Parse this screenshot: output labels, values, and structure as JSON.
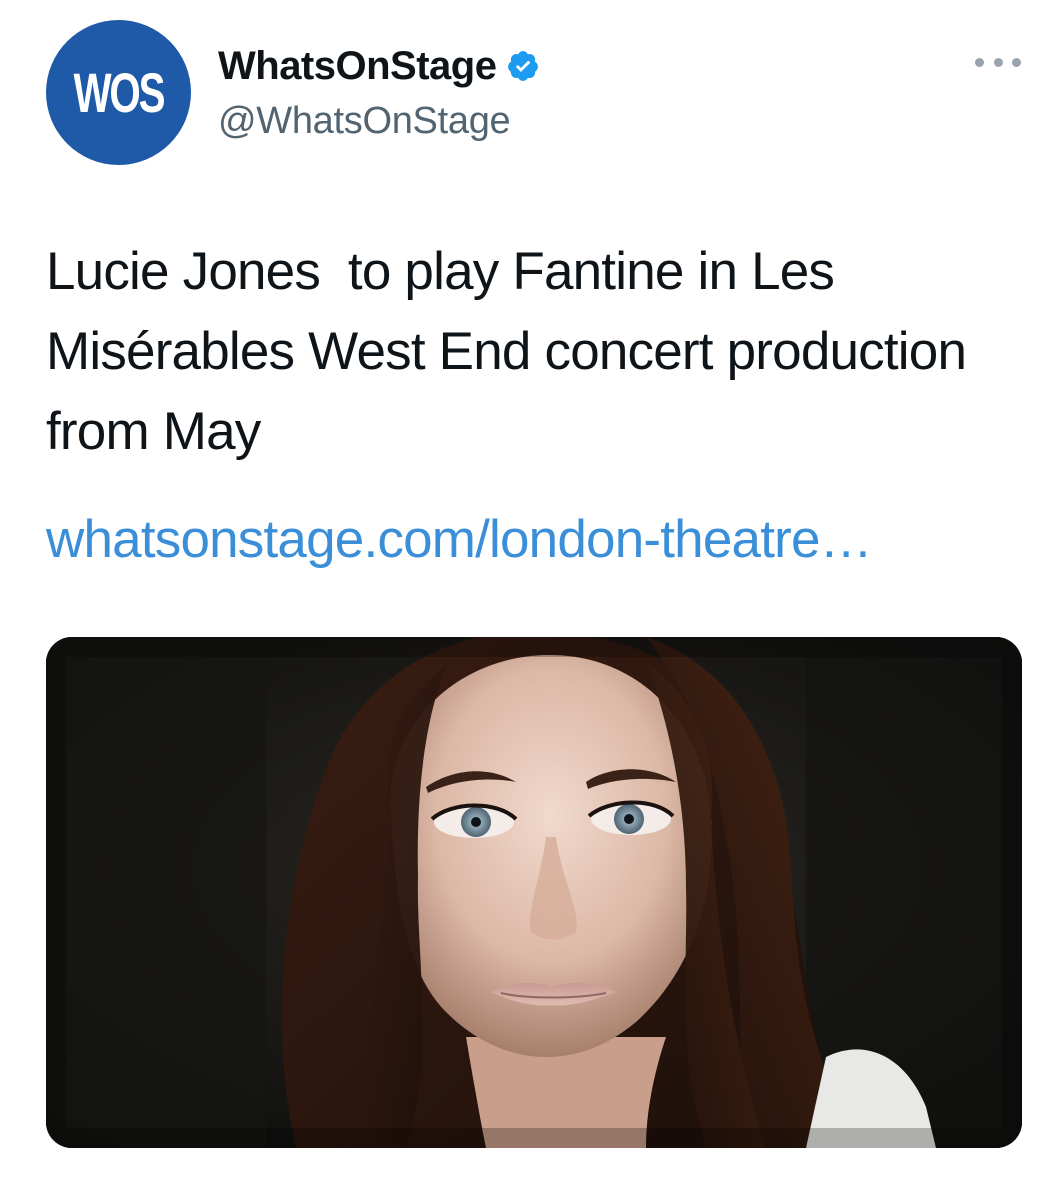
{
  "account": {
    "avatar_text": "WOS",
    "display_name": "WhatsOnStage",
    "handle": "@WhatsOnStage",
    "verified_icon": "verified-badge-icon",
    "avatar_color": "#1f5aa8",
    "verified_color": "#1d9bf0"
  },
  "tweet": {
    "text": "Lucie Jones  to play Fantine in Les Misérables West End concert production from May",
    "link_text": "whatsonstage.com/london-theatre…",
    "link_color": "#3b8fd8"
  },
  "menu": {
    "icon": "more-options-icon"
  },
  "media": {
    "icon": "portrait-photo"
  }
}
